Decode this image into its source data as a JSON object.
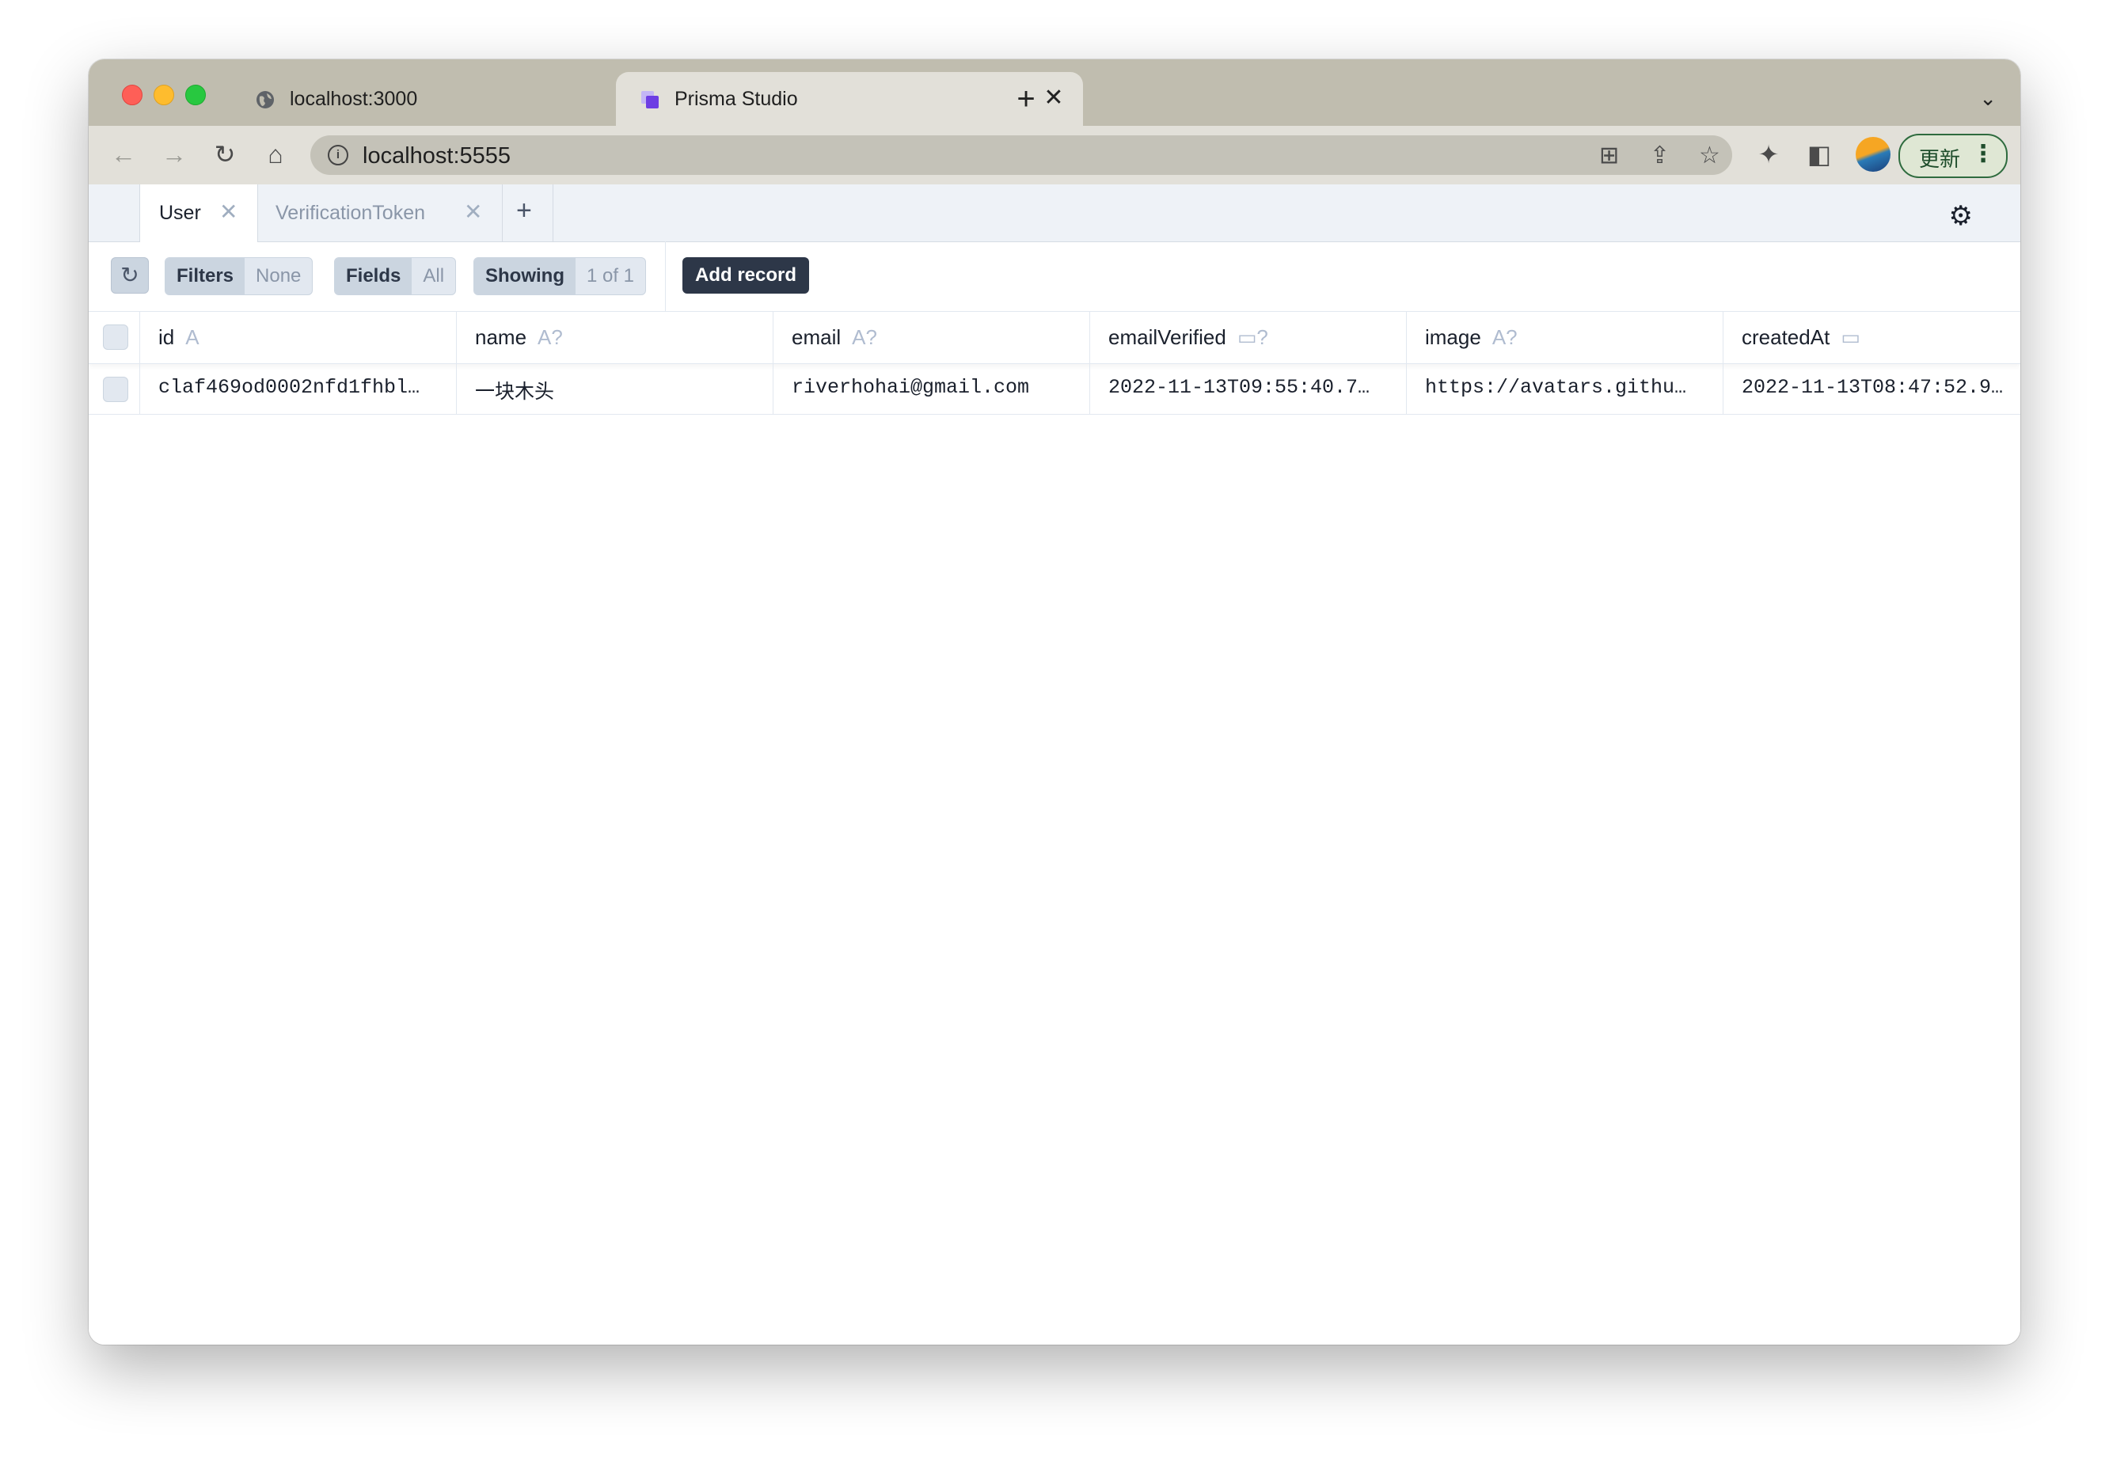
{
  "browser": {
    "tabs": [
      {
        "title": "localhost:3000",
        "favicon": "globe-icon",
        "active": false
      },
      {
        "title": "Prisma Studio",
        "favicon": "prisma-icon",
        "active": true
      }
    ],
    "new_tab_glyph": "+",
    "address": "localhost:5555",
    "update_label": "更新"
  },
  "studio": {
    "model_tabs": [
      {
        "label": "User",
        "active": true
      },
      {
        "label": "VerificationToken",
        "active": false
      }
    ],
    "add_tab_glyph": "+",
    "controls": {
      "filters_label": "Filters",
      "filters_value": "None",
      "fields_label": "Fields",
      "fields_value": "All",
      "showing_label": "Showing",
      "showing_value": "1 of 1",
      "add_record_label": "Add record"
    },
    "columns": [
      {
        "name": "id",
        "type": "A"
      },
      {
        "name": "name",
        "type": "A?"
      },
      {
        "name": "email",
        "type": "A?"
      },
      {
        "name": "emailVerified",
        "type": "▭?"
      },
      {
        "name": "image",
        "type": "A?"
      },
      {
        "name": "createdAt",
        "type": "▭"
      }
    ],
    "rows": [
      {
        "id": "claf469od0002nfd1fhbl…",
        "name": "一块木头",
        "email": "riverhohai@gmail.com",
        "emailVerified": "2022-11-13T09:55:40.7…",
        "image": "https://avatars.githu…",
        "createdAt": "2022-11-13T08:47:52.9…"
      }
    ],
    "horizontal_scroll_fraction": 0.39
  },
  "colors": {
    "chrome_frame": "#c0bdaf",
    "toolbar": "#e2e0d9",
    "add_record_bg": "#2d3748",
    "update_border": "#2e6b3e"
  }
}
